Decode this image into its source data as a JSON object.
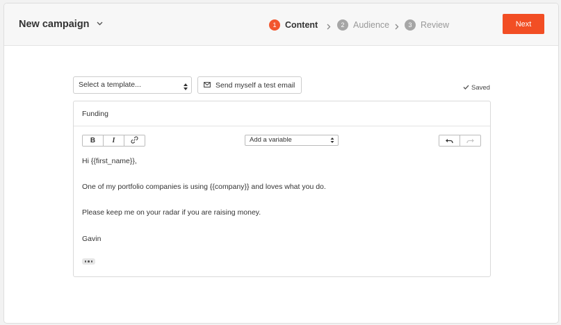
{
  "header": {
    "campaign_title": "New campaign",
    "steps": [
      {
        "number": "1",
        "label": "Content",
        "active": true
      },
      {
        "number": "2",
        "label": "Audience",
        "active": false
      },
      {
        "number": "3",
        "label": "Review",
        "active": false
      }
    ],
    "next_label": "Next"
  },
  "toolbar": {
    "template_placeholder": "Select a template...",
    "test_email_label": "Send myself a test email",
    "saved_label": "Saved"
  },
  "editor": {
    "subject": "Funding",
    "variable_placeholder": "Add a variable",
    "body_lines": [
      "Hi {{first_name}},",
      "One of my portfolio companies is using {{company}} and loves what you do.",
      "Please keep me on your radar if you are raising money.",
      "Gavin"
    ]
  },
  "colors": {
    "accent": "#f24e24",
    "active_step": "#f2562e",
    "inactive_step": "#a6a6a6"
  },
  "icons": {
    "title_dropdown": "chevron-down-icon",
    "step_separator": "chevron-right-icon",
    "test_email": "envelope-icon",
    "saved": "check-icon",
    "bold": "bold-icon",
    "italic": "italic-icon",
    "link": "link-icon",
    "undo": "undo-icon",
    "redo": "redo-icon",
    "more": "ellipsis-icon"
  }
}
